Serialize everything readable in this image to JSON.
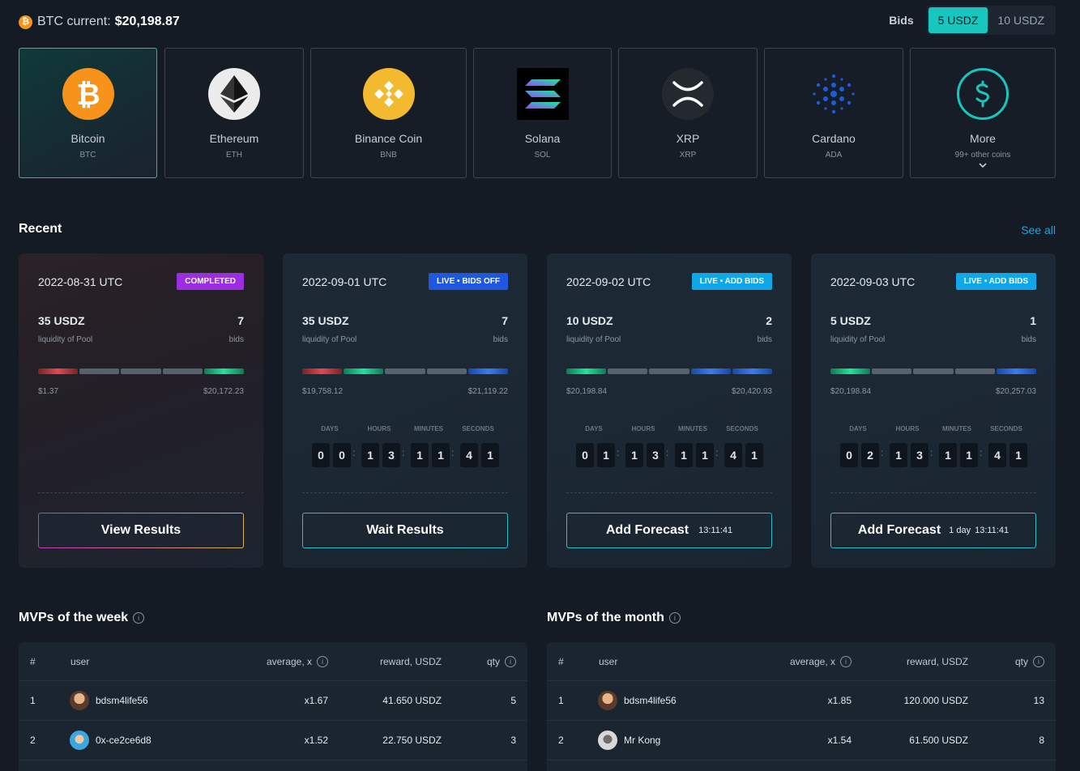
{
  "topbar": {
    "btc_icon": "bitcoin-icon",
    "btc_label": "BTC current:",
    "btc_value": "$20,198.87",
    "bids_label": "Bids",
    "bids_options": [
      "5 USDZ",
      "10 USDZ"
    ],
    "bids_selected": "5 USDZ"
  },
  "coins": [
    {
      "name": "Bitcoin",
      "ticker": "BTC",
      "icon": "bitcoin-icon",
      "color": "#f7931a",
      "selected": true
    },
    {
      "name": "Ethereum",
      "ticker": "ETH",
      "icon": "ethereum-icon",
      "color": "#ececec"
    },
    {
      "name": "Binance Coin",
      "ticker": "BNB",
      "icon": "binance-icon",
      "color": "#f3ba2f"
    },
    {
      "name": "Solana",
      "ticker": "SOL",
      "icon": "solana-icon",
      "color": "#000000"
    },
    {
      "name": "XRP",
      "ticker": "XRP",
      "icon": "xrp-icon",
      "color": "#23292f"
    },
    {
      "name": "Cardano",
      "ticker": "ADA",
      "icon": "cardano-icon",
      "color": "#0033ad"
    },
    {
      "name": "More",
      "ticker": "99+ other coins",
      "icon": "more-coins-icon",
      "color": "#18c6c0"
    }
  ],
  "recent": {
    "title": "Recent",
    "see_all": "See all",
    "cards": [
      {
        "date": "2022-08-31 UTC",
        "badge": "COMPLETED",
        "badge_color": "#9b2ee0",
        "amount": "35 USDZ",
        "amount_label": "liquidity of Pool",
        "bids": "7",
        "bids_label": "bids",
        "low": "$1.37",
        "high": "$20,172.23",
        "button": "View Results"
      },
      {
        "date": "2022-09-01 UTC",
        "badge": "LIVE • BIDS OFF",
        "badge_color": "#1f57e0",
        "amount": "35 USDZ",
        "amount_label": "liquidity of Pool",
        "bids": "7",
        "bids_label": "bids",
        "low": "$19,758.12",
        "high": "$21,119.22",
        "button": "Wait Results",
        "timer": [
          "0",
          "0",
          "1",
          "3",
          "1",
          "1",
          "4",
          "1"
        ]
      },
      {
        "date": "2022-09-02 UTC",
        "badge": "LIVE • ADD BIDS",
        "badge_color": "#10a7e8",
        "amount": "10 USDZ",
        "amount_label": "liquidity of Pool",
        "bids": "2",
        "bids_label": "bids",
        "low": "$20,198.84",
        "high": "$20,420.93",
        "button": "Add Forecast",
        "button_time": "13:11:41",
        "timer": [
          "0",
          "1",
          "1",
          "3",
          "1",
          "1",
          "4",
          "1"
        ]
      },
      {
        "date": "2022-09-03 UTC",
        "badge": "LIVE • ADD BIDS",
        "badge_color": "#10a7e8",
        "amount": "5 USDZ",
        "amount_label": "liquidity of Pool",
        "bids": "1",
        "bids_label": "bids",
        "low": "$20,198.84",
        "high": "$20,257.03",
        "button": "Add Forecast",
        "button_day": "1 day",
        "button_time": "13:11:41",
        "timer": [
          "0",
          "2",
          "1",
          "3",
          "1",
          "1",
          "4",
          "1"
        ]
      }
    ],
    "timer_labels": [
      "DAYS",
      "HOURS",
      "MINUTES",
      "SECONDS"
    ]
  },
  "mvp_week": {
    "title": "MVPs of the week",
    "headers": {
      "rank": "#",
      "user": "user",
      "average": "average, x",
      "reward": "reward, USDZ",
      "qty": "qty"
    },
    "rows": [
      {
        "rank": "1",
        "user": "bdsm4life56",
        "average": "x1.67",
        "reward": "41.650 USDZ",
        "qty": "5"
      },
      {
        "rank": "2",
        "user": "0x-ce2ce6d8",
        "average": "x1.52",
        "reward": "22.750 USDZ",
        "qty": "3"
      }
    ]
  },
  "mvp_month": {
    "title": "MVPs of the month",
    "headers": {
      "rank": "#",
      "user": "user",
      "average": "average, x",
      "reward": "reward, USDZ",
      "qty": "qty"
    },
    "rows": [
      {
        "rank": "1",
        "user": "bdsm4life56",
        "average": "x1.85",
        "reward": "120.000 USDZ",
        "qty": "13"
      },
      {
        "rank": "2",
        "user": "Mr Kong",
        "average": "x1.54",
        "reward": "61.500 USDZ",
        "qty": "8"
      }
    ]
  }
}
